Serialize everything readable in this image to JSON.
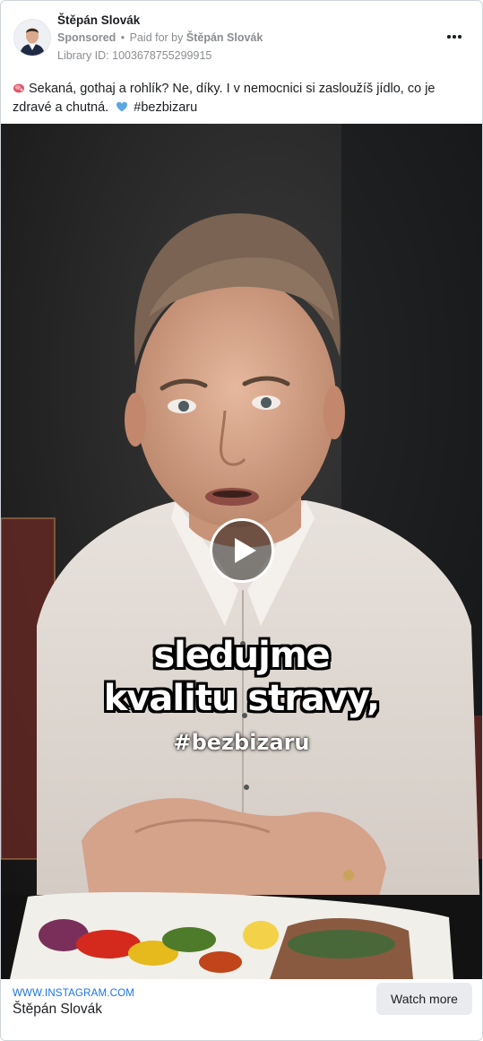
{
  "advertiser": {
    "name": "Štěpán Slovák",
    "sponsored_label": "Sponsored",
    "paid_for_prefix": "Paid for by",
    "paid_for_name": "Štěpán Slovák",
    "library_id": "Library ID: 1003678755299915",
    "avatar_icon": "profile-photo"
  },
  "menu": {
    "icon": "more-options-icon"
  },
  "post": {
    "caption_line": "Sekaná, gothaj a rohlík? Ne, díky. I v nemocnici si zasloužíš jídlo, co je zdravé a chutná.",
    "hashtag": "#bezbizaru",
    "leading_emoji": "meat-emoji",
    "heart_emoji": "blue-heart-emoji"
  },
  "video": {
    "subtitle_line1": "sledujme",
    "subtitle_line2": "kvalitu stravy,",
    "subtitle_hashtag": "#bezbizaru",
    "play_icon": "play-icon"
  },
  "footer": {
    "domain": "WWW.INSTAGRAM.COM",
    "title": "Štěpán Slovák",
    "cta_label": "Watch more"
  },
  "colors": {
    "link_blue": "#1b74e4",
    "text_dark": "#1c1e21",
    "meta_gray": "#8a8d91",
    "button_gray": "#e9ebee"
  }
}
